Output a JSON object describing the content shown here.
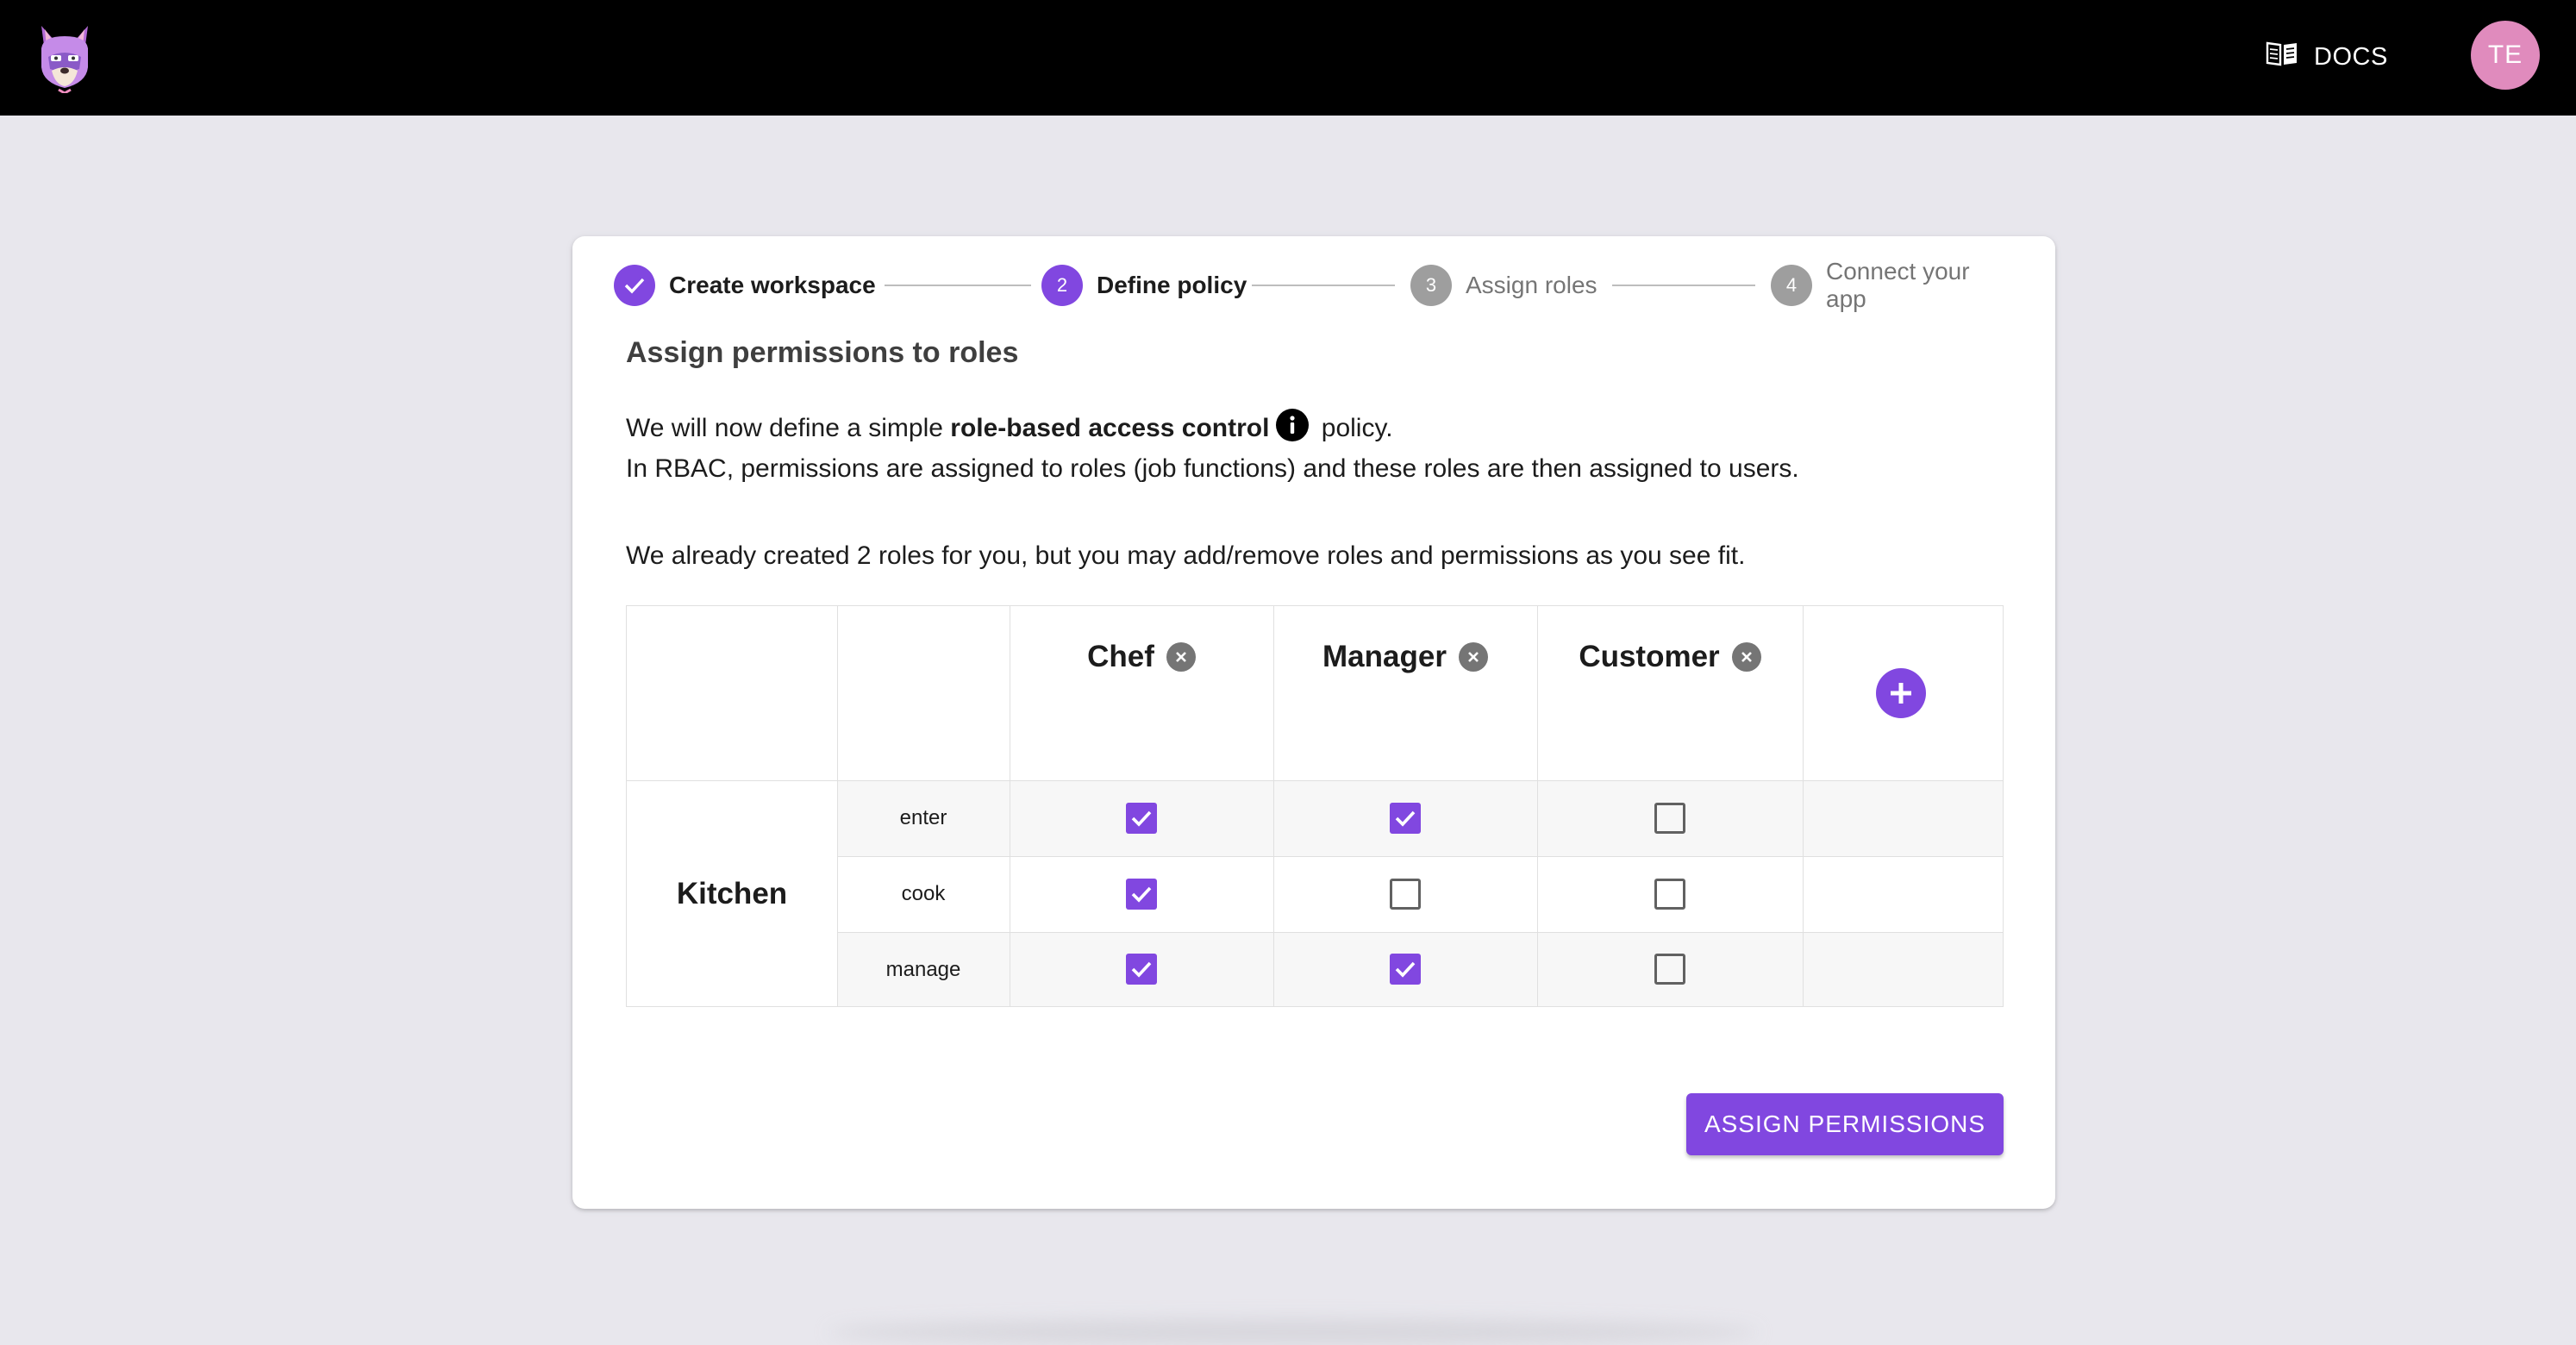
{
  "header": {
    "docs_label": "DOCS",
    "avatar_initials": "TE"
  },
  "stepper": {
    "steps": [
      {
        "number": "",
        "label": "Create workspace",
        "state": "completed"
      },
      {
        "number": "2",
        "label": "Define policy",
        "state": "active"
      },
      {
        "number": "3",
        "label": "Assign roles",
        "state": "inactive"
      },
      {
        "number": "4",
        "label": "Connect your app",
        "state": "inactive"
      }
    ]
  },
  "content": {
    "title": "Assign permissions to roles",
    "line1_prefix": "We will now define a simple ",
    "line1_bold": "role-based access control",
    "line1_suffix": " policy.",
    "line2": "In RBAC, permissions are assigned to roles (job functions) and these roles are then assigned to users.",
    "line3": "We already created 2 roles for you, but you may add/remove roles and permissions as you see fit."
  },
  "table": {
    "roles": [
      "Chef",
      "Manager",
      "Customer"
    ],
    "resource": "Kitchen",
    "actions": [
      "enter",
      "cook",
      "manage"
    ],
    "matrix": [
      [
        true,
        true,
        false
      ],
      [
        true,
        false,
        false
      ],
      [
        true,
        true,
        false
      ]
    ]
  },
  "assign_button_label": "ASSIGN PERMISSIONS",
  "colors": {
    "accent": "#8147e0",
    "header_bg": "#000000",
    "page_bg": "#e8e7ed",
    "avatar": "#e08bbd"
  },
  "icons": {
    "logo": "wolf-logo",
    "docs": "book-icon",
    "info": "info-icon",
    "remove": "remove-circle-icon",
    "add": "add-circle-icon",
    "check": "check-icon"
  }
}
